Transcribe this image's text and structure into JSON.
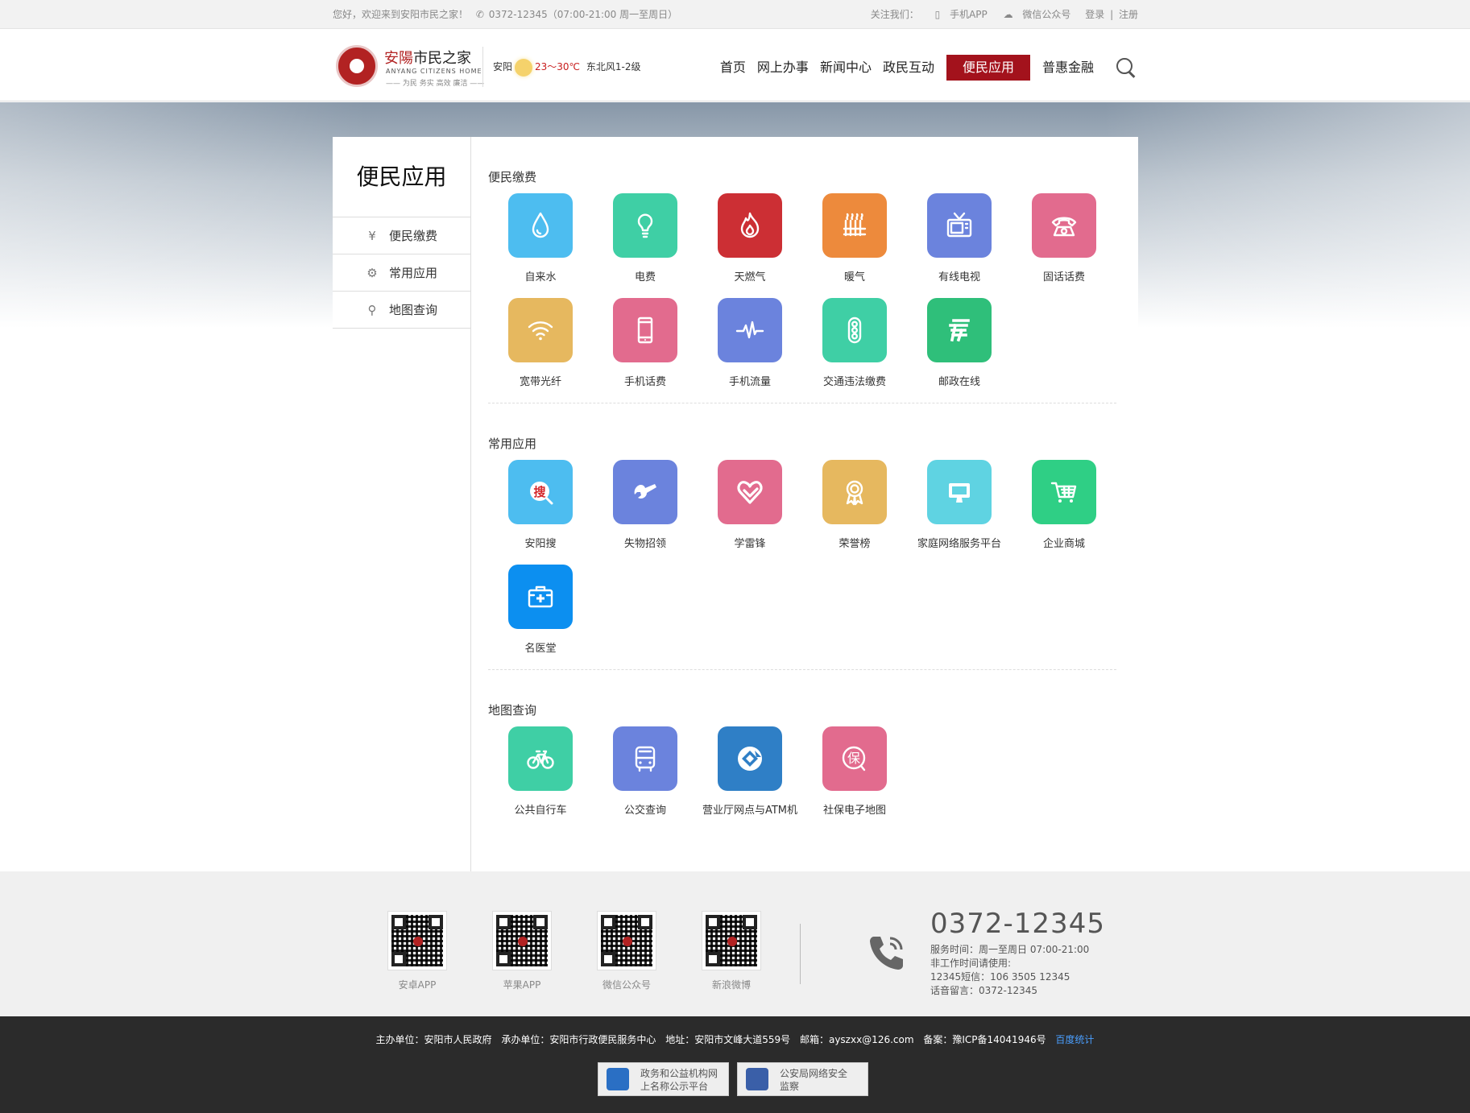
{
  "topbar": {
    "welcome": "您好，欢迎来到安阳市民之家！",
    "hotline": "0372-12345（07:00-21:00 周一至周日）",
    "follow_label": "关注我们：",
    "mobile_app": "手机APP",
    "wechat": "微信公众号",
    "login": "登录",
    "register": "注册"
  },
  "logo": {
    "name_red": "安陽",
    "name_rest": "市民之家",
    "en": "ANYANG CITIZENS HOME",
    "slogan": "—— 为民 务实 高效 廉洁 ——"
  },
  "weather": {
    "city": "安阳",
    "temp": "23～30℃",
    "wind": "东北风1-2级"
  },
  "nav": {
    "items": [
      "首页",
      "网上办事",
      "新闻中心",
      "政民互动",
      "便民应用",
      "普惠金融"
    ],
    "active_index": 4,
    "active_color": "#a3121c"
  },
  "sidebar": {
    "title": "便民应用",
    "items": [
      {
        "label": "便民缴费",
        "icon": "yen-hand-icon"
      },
      {
        "label": "常用应用",
        "icon": "gear-icon"
      },
      {
        "label": "地图查询",
        "icon": "map-pin-icon"
      }
    ]
  },
  "sections": [
    {
      "title": "便民缴费",
      "apps": [
        {
          "label": "自来水",
          "icon": "water-drop-icon",
          "color": "#4dbdf0"
        },
        {
          "label": "电费",
          "icon": "light-bulb-icon",
          "color": "#3fcfa5"
        },
        {
          "label": "天燃气",
          "icon": "flame-icon",
          "color": "#cc2f34"
        },
        {
          "label": "暖气",
          "icon": "radiator-icon",
          "color": "#ed8a3c"
        },
        {
          "label": "有线电视",
          "icon": "tv-icon",
          "color": "#6b83dd"
        },
        {
          "label": "固话话费",
          "icon": "telephone-icon",
          "color": "#e26b8e"
        },
        {
          "label": "宽带光纤",
          "icon": "wifi-icon",
          "color": "#e6b85f"
        },
        {
          "label": "手机话费",
          "icon": "mobile-phone-icon",
          "color": "#e26b8e"
        },
        {
          "label": "手机流量",
          "icon": "pulse-icon",
          "color": "#6b83dd"
        },
        {
          "label": "交通违法缴费",
          "icon": "traffic-light-icon",
          "color": "#3fcfa5"
        },
        {
          "label": "邮政在线",
          "icon": "china-post-icon",
          "color": "#2fbf7a"
        }
      ]
    },
    {
      "title": "常用应用",
      "apps": [
        {
          "label": "安阳搜",
          "icon": "search-sou-icon",
          "color": "#4dbdf0"
        },
        {
          "label": "失物招领",
          "icon": "wrench-icon",
          "color": "#6b83dd"
        },
        {
          "label": "学雷锋",
          "icon": "heart-icon",
          "color": "#e26b8e"
        },
        {
          "label": "荣誉榜",
          "icon": "award-ribbon-icon",
          "color": "#e6b85f"
        },
        {
          "label": "家庭网络服务平台",
          "icon": "monitor-icon",
          "color": "#5fd3e2"
        },
        {
          "label": "企业商城",
          "icon": "shopping-cart-icon",
          "color": "#2fcf85"
        },
        {
          "label": "名医堂",
          "icon": "medical-kit-icon",
          "color": "#0c8ff0"
        }
      ]
    },
    {
      "title": "地图查询",
      "apps": [
        {
          "label": "公共自行车",
          "icon": "bicycle-icon",
          "color": "#3fcfa5"
        },
        {
          "label": "公交查询",
          "icon": "bus-icon",
          "color": "#6b83dd"
        },
        {
          "label": "营业厅网点与ATM机",
          "icon": "ccb-bank-icon",
          "color": "#2f7fc6"
        },
        {
          "label": "社保电子地图",
          "icon": "bao-icon",
          "color": "#e26b8e",
          "glyph": "保"
        }
      ]
    }
  ],
  "special_glyphs": {
    "sou": "搜"
  },
  "qrcodes": [
    {
      "label": "安卓APP"
    },
    {
      "label": "苹果APP"
    },
    {
      "label": "微信公众号"
    },
    {
      "label": "新浪微博"
    }
  ],
  "hotline_block": {
    "number": "0372-12345",
    "lines": [
      "服务时间：周一至周日 07:00-21:00",
      "非工作时间请使用:",
      "12345短信：106 3505 12345",
      "话音留言：0372-12345"
    ]
  },
  "footer": {
    "host": "主办单位：安阳市人民政府",
    "organizer": "承办单位：安阳市行政便民服务中心",
    "address": "地址：安阳市文峰大道559号",
    "email": "邮箱：ayszxx@126.com",
    "icp": "备案：豫ICP备14041946号",
    "stats_link": "百度统计",
    "badges": [
      {
        "line1": "政务和公益机构网",
        "line2": "上名称公示平台",
        "icon": "gov-badge-icon"
      },
      {
        "line1": "公安局网络安全",
        "line2": "监察",
        "icon": "police-badge-icon"
      }
    ]
  }
}
